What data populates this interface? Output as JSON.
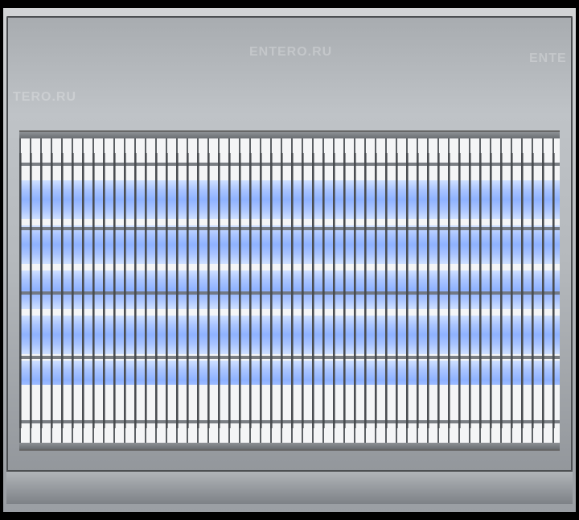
{
  "watermarks": {
    "wm1": "ENTERO.RU",
    "wm2": "ENTE",
    "wm3": "TERO.RU"
  }
}
